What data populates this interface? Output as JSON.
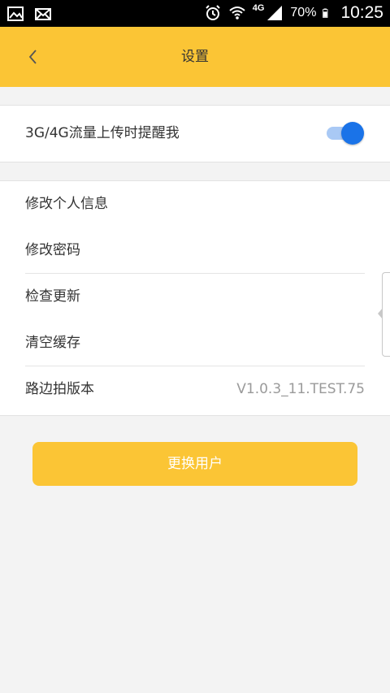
{
  "status_bar": {
    "network": "4G",
    "battery": "70%",
    "time": "10:25",
    "icons": [
      "image-icon",
      "mail-icon",
      "alarm-icon",
      "wifi-icon",
      "signal-icon",
      "battery-icon"
    ]
  },
  "app_bar": {
    "title": "设置",
    "back_icon": "chevron-left-icon"
  },
  "toggle_row": {
    "label": "3G/4G流量上传时提醒我",
    "enabled": true,
    "accent_color": "#1a73e8"
  },
  "list": {
    "items": [
      {
        "label": "修改个人信息"
      },
      {
        "label": "修改密码"
      },
      {
        "label": "检查更新"
      },
      {
        "label": "清空缓存"
      },
      {
        "label": "路边拍版本",
        "value": "V1.0.3_11.TEST.75"
      }
    ]
  },
  "actions": {
    "switch_user_label": "更换用户"
  },
  "colors": {
    "brand_yellow": "#fbc535",
    "background": "#f3f3f3"
  }
}
